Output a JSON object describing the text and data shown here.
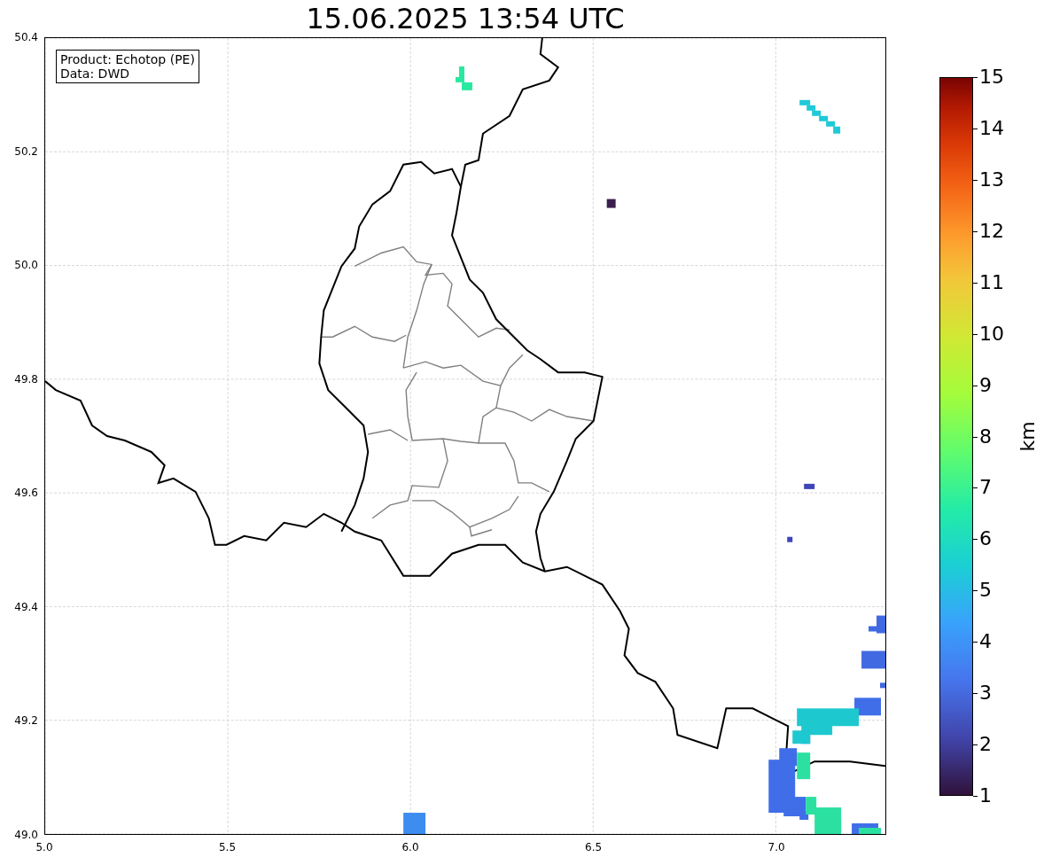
{
  "title": "15.06.2025 13:54 UTC",
  "info_box": {
    "lines": [
      "Product: Echotop (PE)",
      "Data: DWD"
    ]
  },
  "axes": {
    "yticks": [
      "50.4",
      "50.2",
      "50.0",
      "49.8",
      "49.6",
      "49.4",
      "49.2",
      "49.0"
    ],
    "xticks": [
      "5.0",
      "5.5",
      "6.0",
      "6.5",
      "7.0"
    ]
  },
  "colorbar": {
    "label": "km",
    "ticks": [
      "15",
      "14",
      "13",
      "12",
      "11",
      "10",
      "9",
      "8",
      "7",
      "6",
      "5",
      "4",
      "3",
      "2",
      "1"
    ]
  }
}
